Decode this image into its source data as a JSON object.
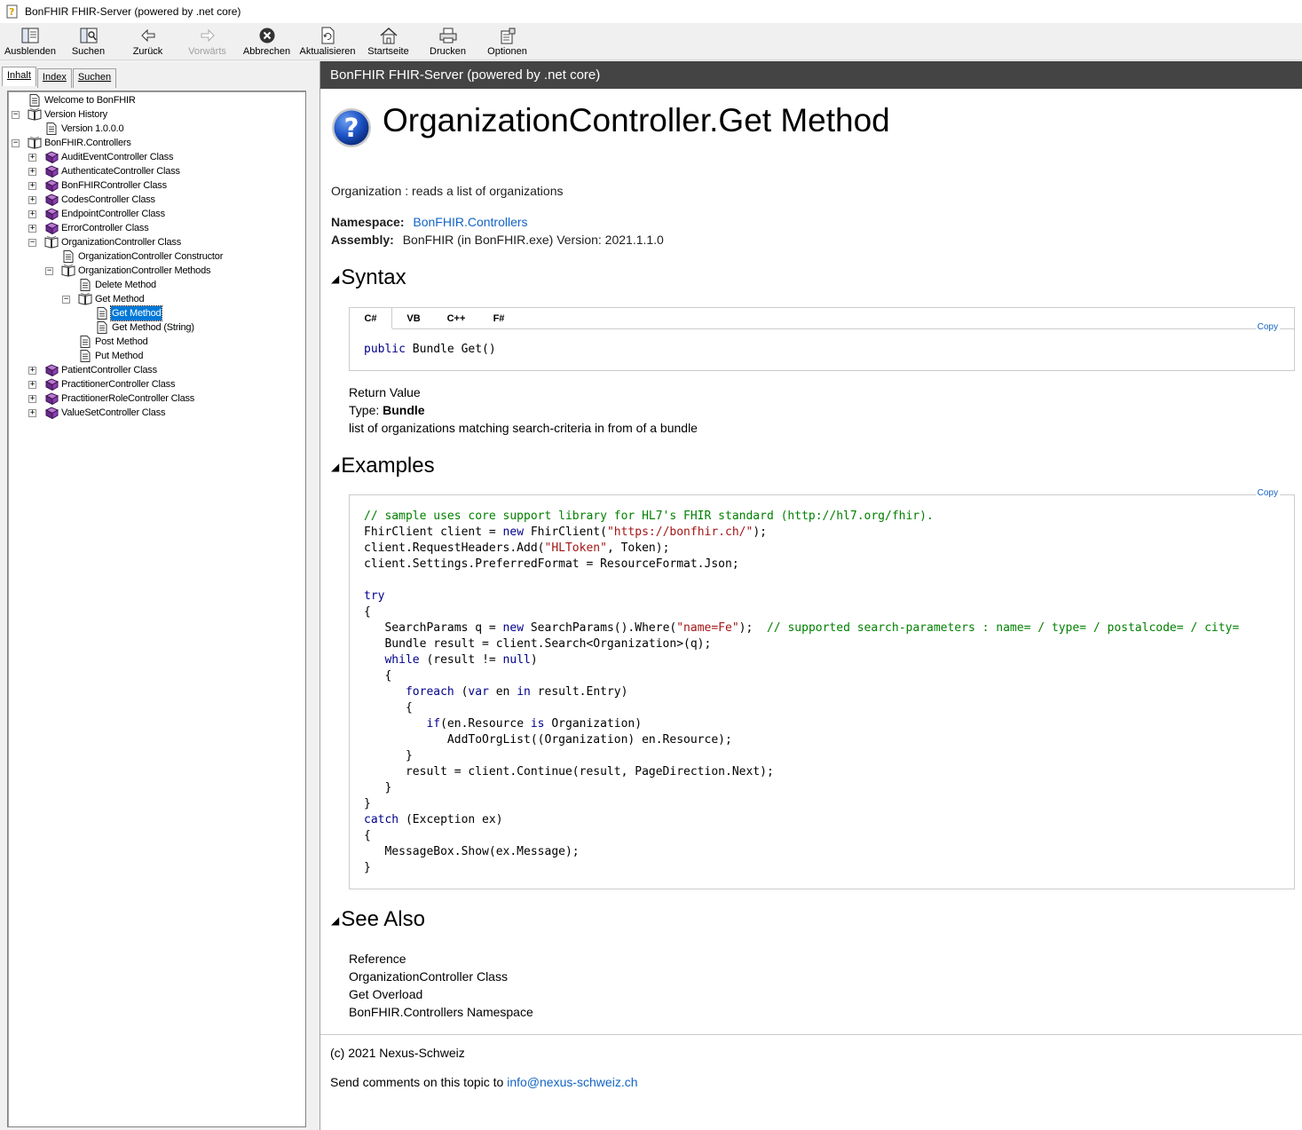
{
  "window": {
    "title": "BonFHIR FHIR-Server (powered by .net core)"
  },
  "toolbar": {
    "buttons": [
      {
        "label": "Ausblenden",
        "icon": "hide-pane-icon"
      },
      {
        "label": "Suchen",
        "icon": "search-icon"
      },
      {
        "label": "Zurück",
        "icon": "back-arrow-icon"
      },
      {
        "label": "Vorwärts",
        "icon": "forward-arrow-icon",
        "disabled": true
      },
      {
        "label": "Abbrechen",
        "icon": "stop-icon"
      },
      {
        "label": "Aktualisieren",
        "icon": "refresh-icon"
      },
      {
        "label": "Startseite",
        "icon": "home-icon"
      },
      {
        "label": "Drucken",
        "icon": "print-icon"
      },
      {
        "label": "Optionen",
        "icon": "options-icon"
      }
    ]
  },
  "nav_tabs": [
    "Inhalt",
    "Index",
    "Suchen"
  ],
  "tree": [
    {
      "label": "Welcome to BonFHIR",
      "level": 0,
      "icon": "page",
      "exp": ""
    },
    {
      "label": "Version History",
      "level": 0,
      "icon": "book-open",
      "exp": "-"
    },
    {
      "label": "Version 1.0.0.0",
      "level": 1,
      "icon": "page",
      "exp": ""
    },
    {
      "label": "BonFHIR.Controllers",
      "level": 0,
      "icon": "book-open",
      "exp": "-"
    },
    {
      "label": "AuditEventController Class",
      "level": 1,
      "icon": "book-closed",
      "exp": "+"
    },
    {
      "label": "AuthenticateController Class",
      "level": 1,
      "icon": "book-closed",
      "exp": "+"
    },
    {
      "label": "BonFHIRController Class",
      "level": 1,
      "icon": "book-closed",
      "exp": "+"
    },
    {
      "label": "CodesController Class",
      "level": 1,
      "icon": "book-closed",
      "exp": "+"
    },
    {
      "label": "EndpointController Class",
      "level": 1,
      "icon": "book-closed",
      "exp": "+"
    },
    {
      "label": "ErrorController Class",
      "level": 1,
      "icon": "book-closed",
      "exp": "+"
    },
    {
      "label": "OrganizationController Class",
      "level": 1,
      "icon": "book-open",
      "exp": "-"
    },
    {
      "label": "OrganizationController Constructor",
      "level": 2,
      "icon": "page",
      "exp": ""
    },
    {
      "label": "OrganizationController Methods",
      "level": 2,
      "icon": "book-open",
      "exp": "-"
    },
    {
      "label": "Delete Method",
      "level": 3,
      "icon": "page",
      "exp": ""
    },
    {
      "label": "Get Method",
      "level": 3,
      "icon": "book-open",
      "exp": "-"
    },
    {
      "label": "Get Method",
      "level": 4,
      "icon": "page",
      "exp": "",
      "selected": true
    },
    {
      "label": "Get Method (String)",
      "level": 4,
      "icon": "page",
      "exp": ""
    },
    {
      "label": "Post Method",
      "level": 3,
      "icon": "page",
      "exp": ""
    },
    {
      "label": "Put Method",
      "level": 3,
      "icon": "page",
      "exp": ""
    },
    {
      "label": "PatientController Class",
      "level": 1,
      "icon": "book-closed",
      "exp": "+"
    },
    {
      "label": "PractitionerController Class",
      "level": 1,
      "icon": "book-closed",
      "exp": "+"
    },
    {
      "label": "PractitionerRoleController Class",
      "level": 1,
      "icon": "book-closed",
      "exp": "+"
    },
    {
      "label": "ValueSetController Class",
      "level": 1,
      "icon": "book-closed",
      "exp": "+"
    }
  ],
  "page": {
    "header": "BonFHIR FHIR-Server (powered by .net core)",
    "title": "OrganizationController.Get Method",
    "summary": "Organization : reads a list of organizations",
    "namespace_label": "Namespace:",
    "namespace_value": "BonFHIR.Controllers",
    "assembly_label": "Assembly:",
    "assembly_value": "BonFHIR (in BonFHIR.exe) Version: 2021.1.1.0",
    "syntax_heading": "Syntax",
    "lang_tabs": [
      "C#",
      "VB",
      "C++",
      "F#"
    ],
    "copy_label": "Copy",
    "return_value_heading": "Return Value",
    "type_label": "Type:",
    "type_value": "Bundle",
    "return_desc": "list of organizations matching search-criteria in from of a bundle",
    "examples_heading": "Examples",
    "see_also_heading": "See Also",
    "reference_heading": "Reference",
    "see_also_links": [
      "OrganizationController Class",
      "Get Overload",
      "BonFHIR.Controllers Namespace"
    ],
    "copyright": "(c) 2021 Nexus-Schweiz",
    "comments_text": "Send comments on this topic to",
    "comments_email": "info@nexus-schweiz.ch"
  }
}
